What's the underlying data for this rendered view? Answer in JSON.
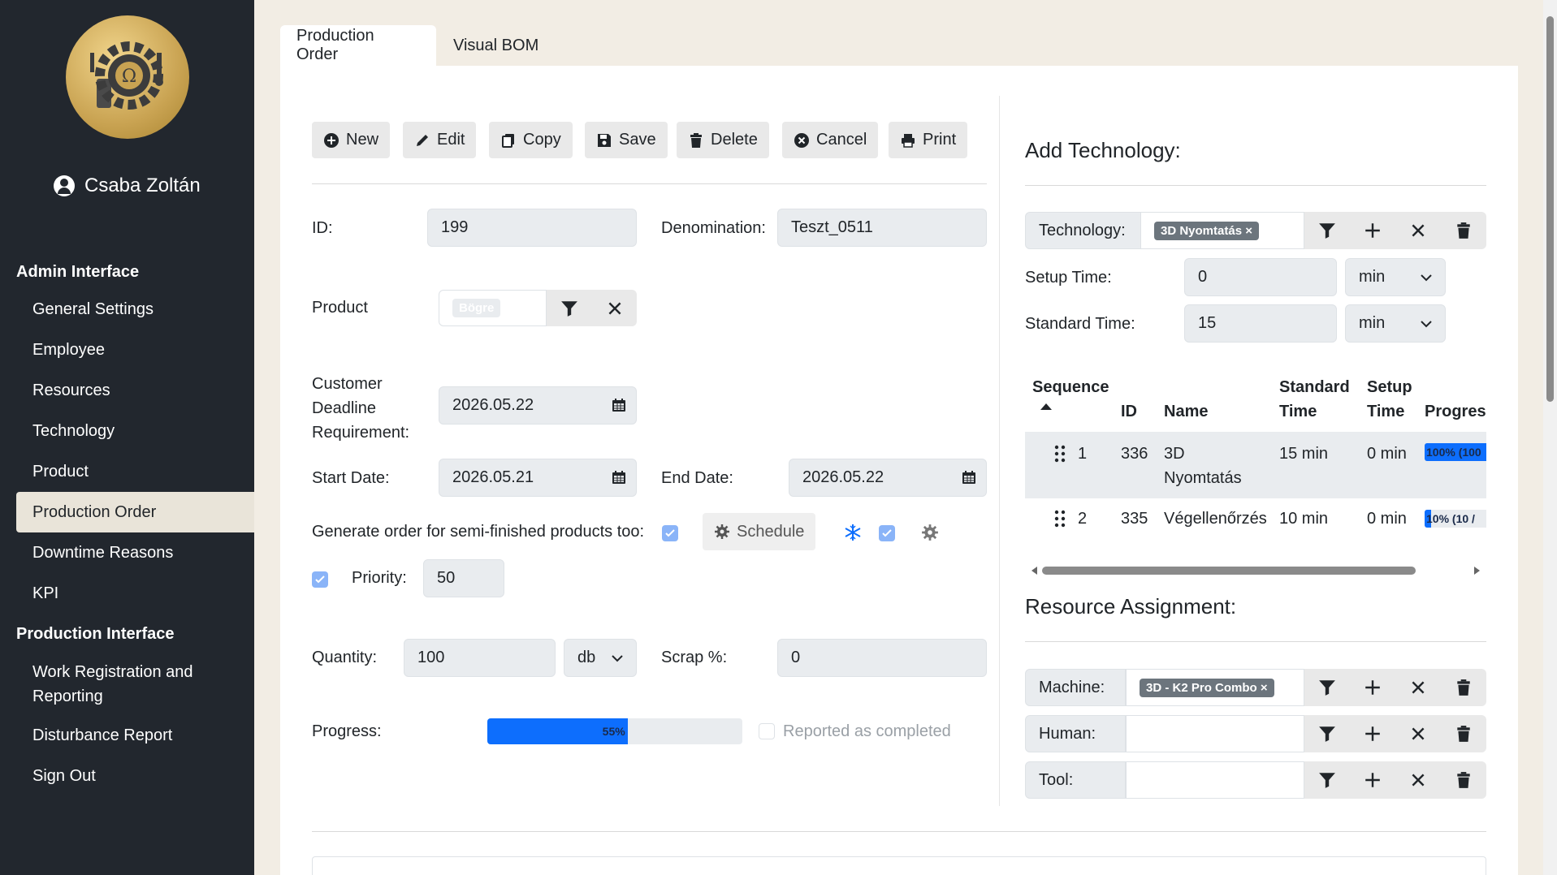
{
  "user": {
    "name": "Csaba Zoltán"
  },
  "sidebar": {
    "admin_title": "Admin Interface",
    "admin_items": [
      {
        "label": "General Settings"
      },
      {
        "label": "Employee"
      },
      {
        "label": "Resources"
      },
      {
        "label": "Technology"
      },
      {
        "label": "Product"
      },
      {
        "label": "Production Order",
        "active": true
      },
      {
        "label": "Downtime Reasons"
      },
      {
        "label": "KPI"
      }
    ],
    "production_title": "Production Interface",
    "production_items": [
      {
        "label": "Work Registration and Reporting"
      },
      {
        "label": "Disturbance Report"
      },
      {
        "label": "Sign Out"
      }
    ]
  },
  "tabs": [
    {
      "label": "Production Order",
      "active": true
    },
    {
      "label": "Visual BOM"
    }
  ],
  "toolbar": {
    "new": "New",
    "edit": "Edit",
    "copy": "Copy",
    "save": "Save",
    "delete": "Delete",
    "cancel": "Cancel",
    "print": "Print"
  },
  "form": {
    "id_label": "ID:",
    "id_value": "199",
    "denomination_label": "Denomination:",
    "denomination_value": "Teszt_0511",
    "product_label": "Product",
    "product_tag": "Bögre",
    "deadline_label_1": "Customer",
    "deadline_label_2": "Deadline",
    "deadline_label_3": "Requirement:",
    "deadline_value": "2026.05.22",
    "start_label": "Start Date:",
    "start_value": "2026.05.21",
    "end_label": "End Date:",
    "end_value": "2026.05.22",
    "semi_label": "Generate order for semi-finished products too:",
    "schedule_label": "Schedule",
    "priority_label": "Priority:",
    "priority_value": "50",
    "quantity_label": "Quantity:",
    "quantity_value": "100",
    "quantity_unit": "db",
    "scrap_label": "Scrap %:",
    "scrap_value": "0",
    "progress_label": "Progress:",
    "progress_value": 55,
    "progress_text": "55%",
    "reported_label": "Reported as completed"
  },
  "technology": {
    "title": "Add Technology:",
    "tech_label": "Technology:",
    "tech_tag": "3D Nyomtatás",
    "setup_label": "Setup Time:",
    "setup_value": "0",
    "setup_unit": "min",
    "standard_label": "Standard Time:",
    "standard_value": "15",
    "standard_unit": "min",
    "columns": {
      "sequence": "Sequence",
      "id": "ID",
      "name": "Name",
      "standard_1": "Standard",
      "standard_2": "Time",
      "setup_1": "Setup",
      "setup_2": "Time",
      "progress": "Progress"
    },
    "rows": [
      {
        "seq": "1",
        "id": "336",
        "name_1": "3D",
        "name_2": "Nyomtatás",
        "standard": "15 min",
        "setup": "0 min",
        "progress_text": "100% (100",
        "progress": 100
      },
      {
        "seq": "2",
        "id": "335",
        "name_1": "Végellenőrzés",
        "name_2": "",
        "standard": "10 min",
        "setup": "0 min",
        "progress_text": "10% (10 /",
        "progress": 10
      }
    ]
  },
  "resources": {
    "title": "Resource Assignment:",
    "machine_label": "Machine:",
    "machine_tag": "3D - K2 Pro Combo",
    "human_label": "Human:",
    "tool_label": "Tool:"
  },
  "colors": {
    "sidebar": "#22272e",
    "accent": "#0d6efd",
    "active_bg": "#e9e4d9"
  }
}
